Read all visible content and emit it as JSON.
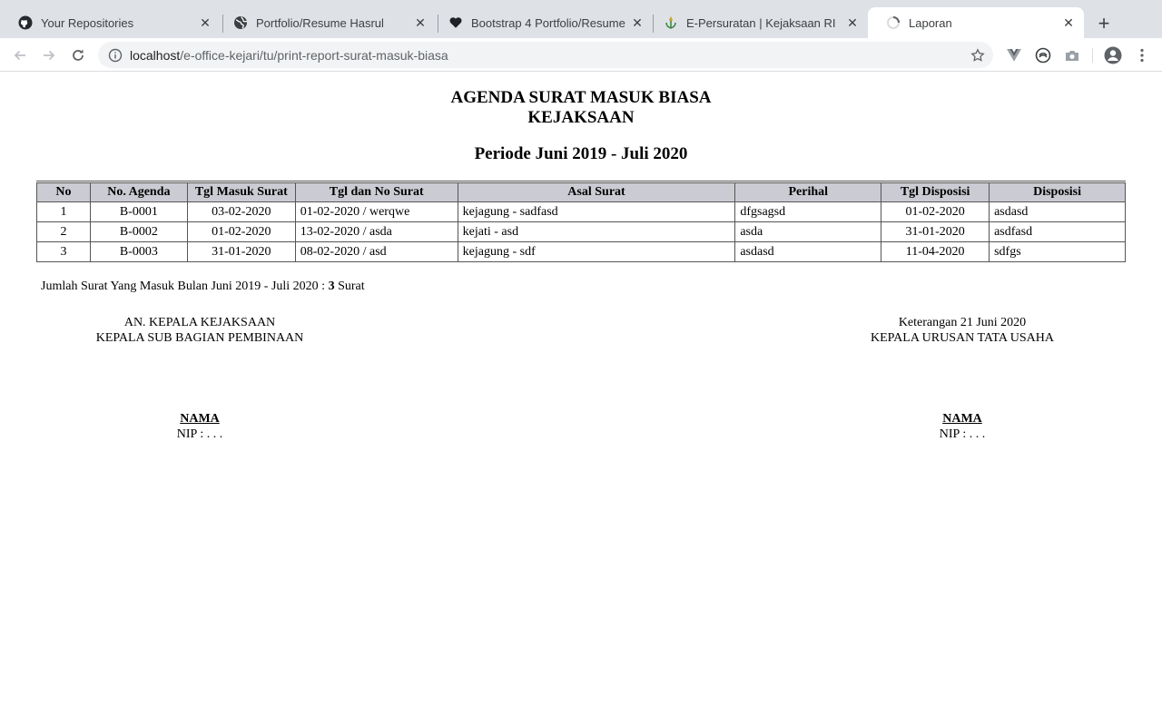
{
  "browser": {
    "tabs": [
      {
        "title": "Your Repositories",
        "icon": "github-icon",
        "active": false
      },
      {
        "title": "Portfolio/Resume Hasrul",
        "icon": "globe-icon",
        "active": false
      },
      {
        "title": "Bootstrap 4 Portfolio/Resume",
        "icon": "heart-icon",
        "active": false
      },
      {
        "title": "E-Persuratan | Kejaksaan RI",
        "icon": "kejaksaan-logo-icon",
        "active": false
      },
      {
        "title": "Laporan",
        "icon": "loading-icon",
        "active": true
      }
    ],
    "address": {
      "host": "localhost",
      "path": "/e-office-kejari/tu/print-report-surat-masuk-biasa"
    }
  },
  "report": {
    "title_line1": "AGENDA SURAT MASUK BIASA",
    "title_line2": "KEJAKSAAN",
    "periode": "Periode Juni 2019 - Juli 2020",
    "columns": [
      "No",
      "No. Agenda",
      "Tgl Masuk Surat",
      "Tgl dan No Surat",
      "Asal Surat",
      "Perihal",
      "Tgl Disposisi",
      "Disposisi"
    ],
    "rows": [
      [
        "1",
        "B-0001",
        "03-02-2020",
        "01-02-2020 / werqwe",
        "kejagung - sadfasd",
        "dfgsagsd",
        "01-02-2020",
        "asdasd"
      ],
      [
        "2",
        "B-0002",
        "01-02-2020",
        "13-02-2020 / asda",
        "kejati - asd",
        "asda",
        "31-01-2020",
        "asdfasd"
      ],
      [
        "3",
        "B-0003",
        "31-01-2020",
        "08-02-2020 / asd",
        "kejagung - sdf",
        "asdasd",
        "11-04-2020",
        "sdfgs"
      ]
    ],
    "summary_prefix": "Jumlah Surat Yang Masuk Bulan Juni 2019 - Juli 2020 : ",
    "summary_count": "3",
    "summary_suffix": " Surat",
    "signature_left": {
      "line1": "AN. KEPALA KEJAKSAAN",
      "line2": "KEPALA SUB BAGIAN PEMBINAAN",
      "name": "NAMA",
      "nip": "NIP : . . ."
    },
    "signature_right": {
      "line1": "Keterangan 21 Juni 2020",
      "line2": "KEPALA URUSAN TATA USAHA",
      "name": "NAMA",
      "nip": "NIP : . . ."
    }
  }
}
